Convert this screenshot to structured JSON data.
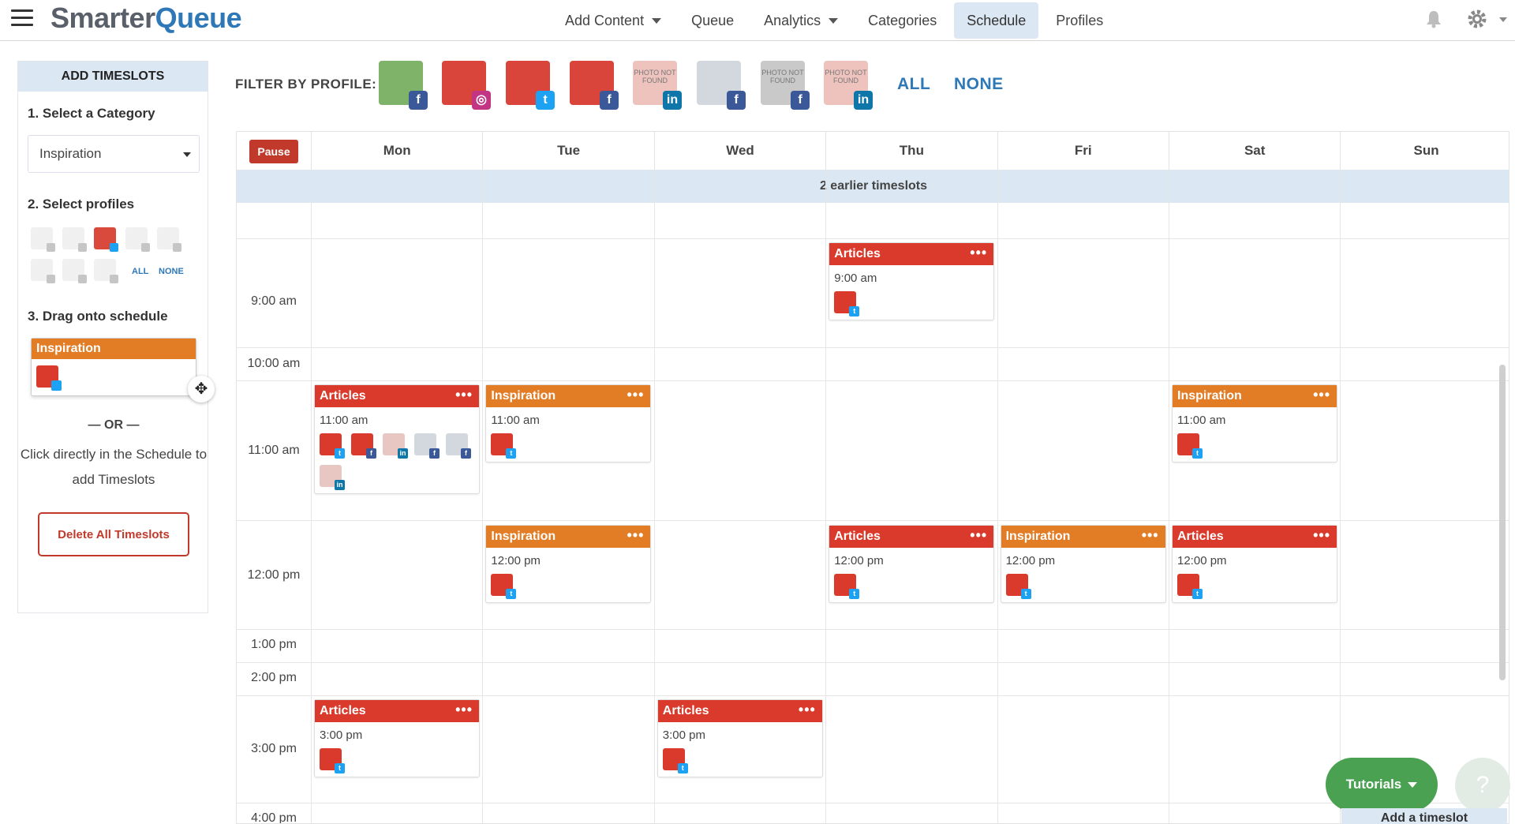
{
  "app": {
    "logo_part1": "Smarter",
    "logo_part2": "Queue"
  },
  "nav": {
    "items": [
      {
        "label": "Add Content",
        "dropdown": true
      },
      {
        "label": "Queue",
        "dropdown": false
      },
      {
        "label": "Analytics",
        "dropdown": true
      },
      {
        "label": "Categories",
        "dropdown": false
      },
      {
        "label": "Schedule",
        "dropdown": false,
        "active": true
      },
      {
        "label": "Profiles",
        "dropdown": false
      }
    ]
  },
  "sidebar": {
    "title": "ADD TIMESLOTS",
    "step1": "1. Select a Category",
    "category_value": "Inspiration",
    "step2": "2. Select profiles",
    "all": "ALL",
    "none": "NONE",
    "step3": "3. Drag onto schedule",
    "drag_card_label": "Inspiration",
    "or": "— OR —",
    "hint": "Click directly in the Schedule to add Timeslots",
    "delete_button": "Delete All Timeslots"
  },
  "filter": {
    "label": "FILTER BY PROFILE:",
    "all": "ALL",
    "none": "NONE",
    "profiles": [
      {
        "network": "facebook",
        "badge": "f"
      },
      {
        "network": "instagram",
        "badge": "◎"
      },
      {
        "network": "twitter",
        "badge": "t"
      },
      {
        "network": "facebook",
        "badge": "f"
      },
      {
        "network": "linkedin",
        "badge": "in",
        "photo_text": "PHOTO NOT FOUND"
      },
      {
        "network": "facebook",
        "badge": "f"
      },
      {
        "network": "facebook",
        "badge": "f",
        "photo_text": "PHOTO NOT FOUND"
      },
      {
        "network": "linkedin",
        "badge": "in",
        "photo_text": "PHOTO NOT FOUND"
      }
    ]
  },
  "calendar": {
    "pause": "Pause",
    "days": [
      "Mon",
      "Tue",
      "Wed",
      "Thu",
      "Fri",
      "Sat",
      "Sun"
    ],
    "earlier": "2 earlier timeslots",
    "times": [
      "9:00 am",
      "10:00 am",
      "11:00 am",
      "12:00 pm",
      "1:00 pm",
      "2:00 pm",
      "3:00 pm",
      "4:00 pm"
    ],
    "timeslots": [
      {
        "category": "Articles",
        "color": "#d93a2b",
        "day": "Thu",
        "time": "9:00 am",
        "profiles": [
          "twitter"
        ]
      },
      {
        "category": "Articles",
        "color": "#d93a2b",
        "day": "Mon",
        "time": "11:00 am",
        "profiles": [
          "twitter",
          "facebook",
          "linkedin",
          "facebook",
          "facebook",
          "linkedin"
        ]
      },
      {
        "category": "Inspiration",
        "color": "#e27c25",
        "day": "Tue",
        "time": "11:00 am",
        "profiles": [
          "twitter"
        ]
      },
      {
        "category": "Inspiration",
        "color": "#e27c25",
        "day": "Sat",
        "time": "11:00 am",
        "profiles": [
          "twitter"
        ]
      },
      {
        "category": "Inspiration",
        "color": "#e27c25",
        "day": "Tue",
        "time": "12:00 pm",
        "profiles": [
          "twitter"
        ]
      },
      {
        "category": "Articles",
        "color": "#d93a2b",
        "day": "Thu",
        "time": "12:00 pm",
        "profiles": [
          "twitter"
        ]
      },
      {
        "category": "Inspiration",
        "color": "#e27c25",
        "day": "Fri",
        "time": "12:00 pm",
        "profiles": [
          "twitter"
        ]
      },
      {
        "category": "Articles",
        "color": "#d93a2b",
        "day": "Sat",
        "time": "12:00 pm",
        "profiles": [
          "twitter"
        ]
      },
      {
        "category": "Articles",
        "color": "#d93a2b",
        "day": "Mon",
        "time": "3:00 pm",
        "profiles": [
          "twitter"
        ]
      },
      {
        "category": "Articles",
        "color": "#d93a2b",
        "day": "Wed",
        "time": "3:00 pm",
        "profiles": [
          "twitter"
        ]
      }
    ],
    "slot_menu": "•••"
  },
  "footer": {
    "tutorials": "Tutorials",
    "help": "?",
    "add_timeslot": "Add a timeslot"
  },
  "colors": {
    "accent": "#2f78b7",
    "articles": "#d93a2b",
    "inspiration": "#e27c25",
    "active_tab": "#dbe7f2",
    "tutorials": "#4aa152"
  }
}
